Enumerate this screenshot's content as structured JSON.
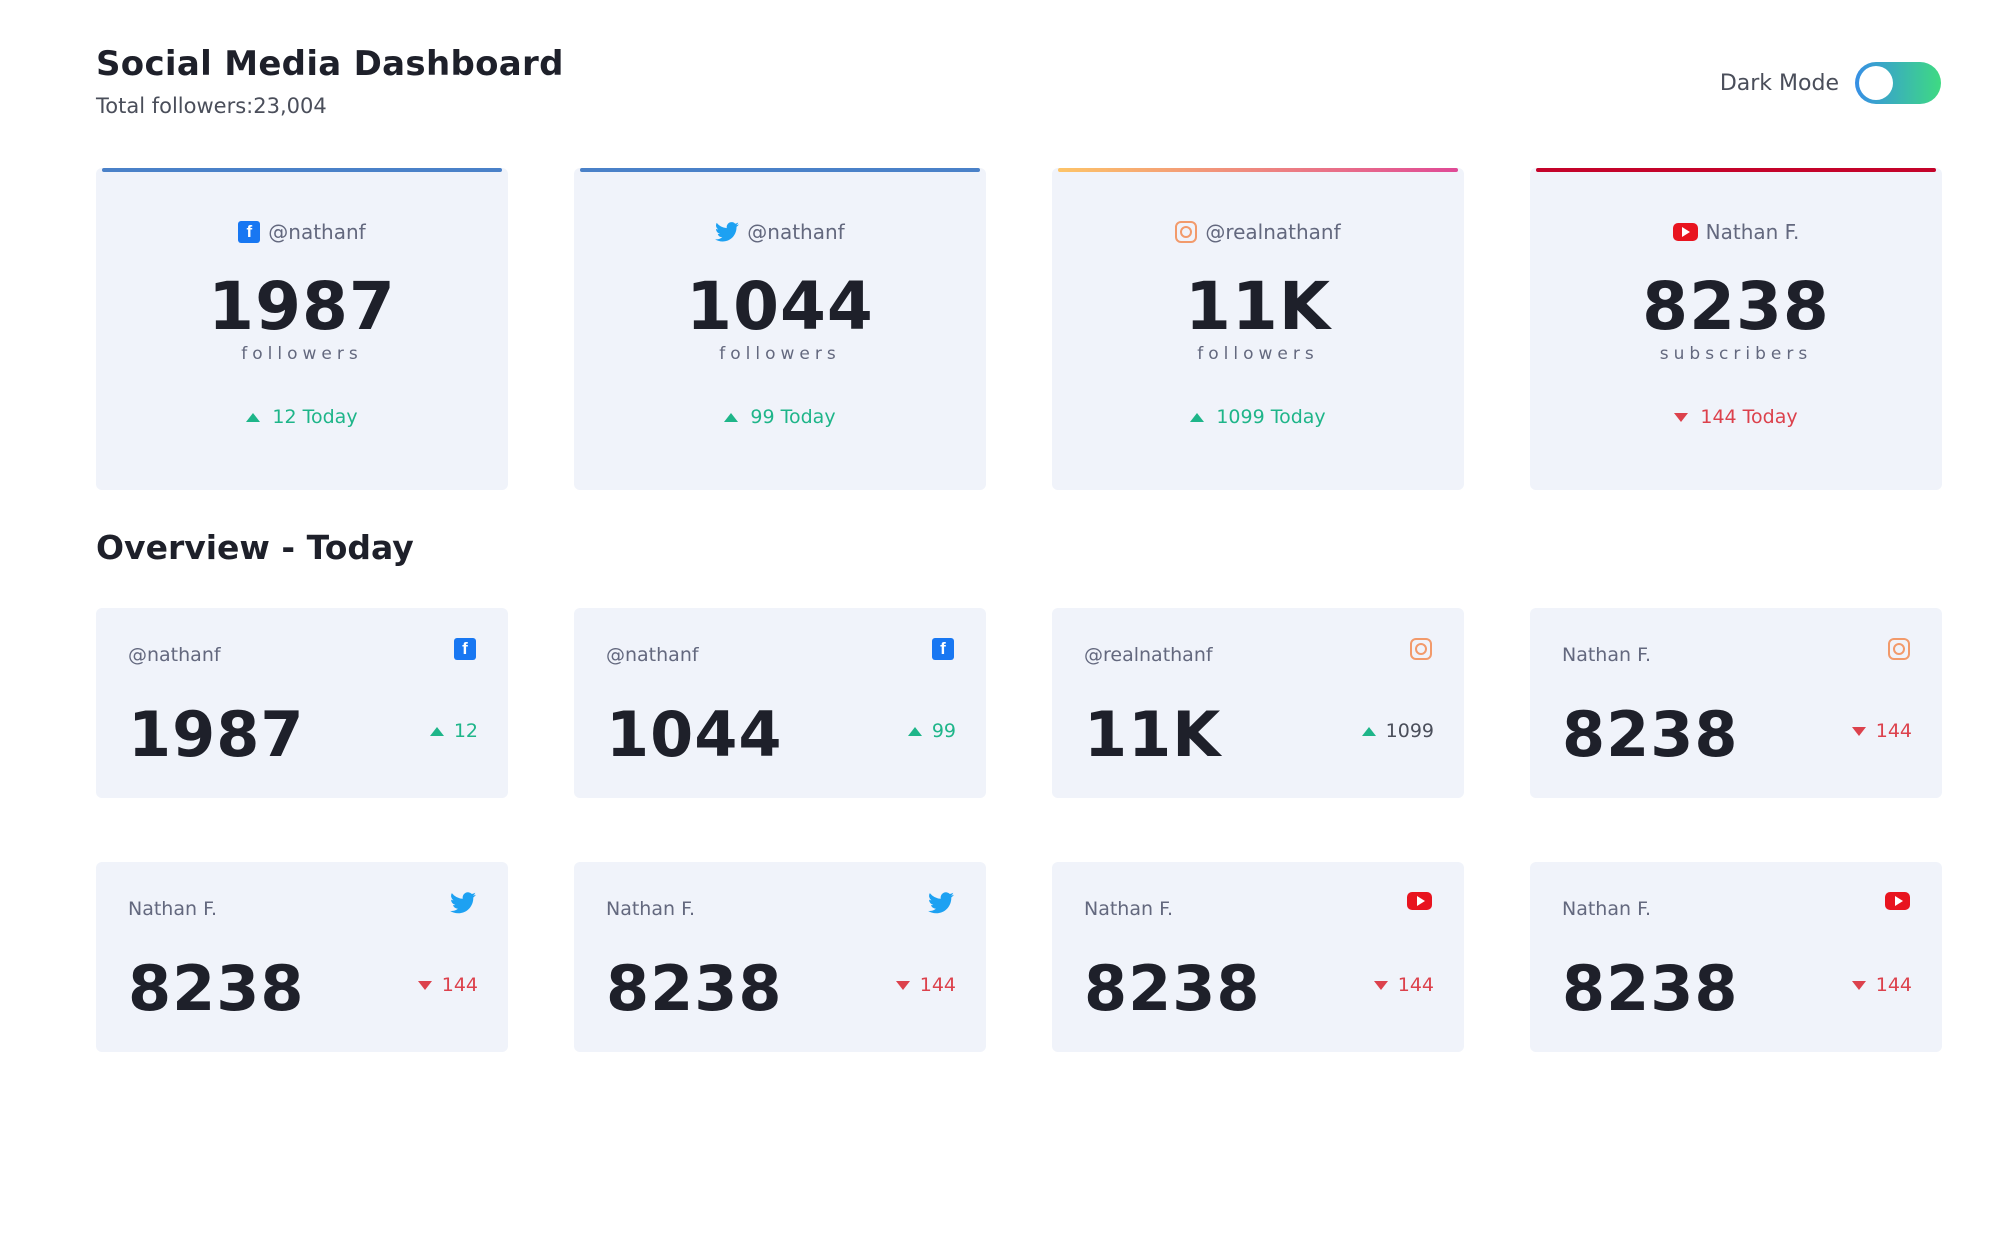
{
  "header": {
    "title": "Social Media Dashboard",
    "total_followers": "Total followers:23,004",
    "dark_mode_label": "Dark Mode"
  },
  "top_cards": [
    {
      "platform": "facebook",
      "icon": "facebook-icon",
      "handle": "@nathanf",
      "count": "1987",
      "label": "followers",
      "today": "12 Today",
      "trend": "up"
    },
    {
      "platform": "twitter",
      "icon": "twitter-icon",
      "handle": "@nathanf",
      "count": "1044",
      "label": "followers",
      "today": "99 Today",
      "trend": "up"
    },
    {
      "platform": "instagram",
      "icon": "instagram-icon",
      "handle": "@realnathanf",
      "count": "11K",
      "label": "followers",
      "today": "1099 Today",
      "trend": "up"
    },
    {
      "platform": "youtube",
      "icon": "youtube-icon",
      "handle": "Nathan F.",
      "count": "8238",
      "label": "subscribers",
      "today": "144 Today",
      "trend": "down"
    }
  ],
  "overview": {
    "title": "Overview - Today",
    "cards": [
      {
        "label": "@nathanf",
        "icon": "facebook-icon",
        "value": "1987",
        "change": "12",
        "trend": "up"
      },
      {
        "label": "@nathanf",
        "icon": "facebook-icon",
        "value": "1044",
        "change": "99",
        "trend": "up"
      },
      {
        "label": "@realnathanf",
        "icon": "instagram-icon",
        "value": "11K",
        "change": "1099",
        "trend": "up"
      },
      {
        "label": "Nathan F.",
        "icon": "instagram-icon",
        "value": "8238",
        "change": "144",
        "trend": "down"
      },
      {
        "label": "Nathan F.",
        "icon": "twitter-icon",
        "value": "8238",
        "change": "144",
        "trend": "down"
      },
      {
        "label": "Nathan F.",
        "icon": "twitter-icon",
        "value": "8238",
        "change": "144",
        "trend": "down"
      },
      {
        "label": "Nathan F.",
        "icon": "youtube-icon",
        "value": "8238",
        "change": "144",
        "trend": "down"
      },
      {
        "label": "Nathan F.",
        "icon": "youtube-icon",
        "value": "8238",
        "change": "144",
        "trend": "down"
      }
    ]
  },
  "colors": {
    "up": "#1eb589",
    "down": "#dc414c",
    "card_bg": "#f0f3fa",
    "toggle_start": "#378fe6",
    "toggle_end": "#3eda82"
  }
}
